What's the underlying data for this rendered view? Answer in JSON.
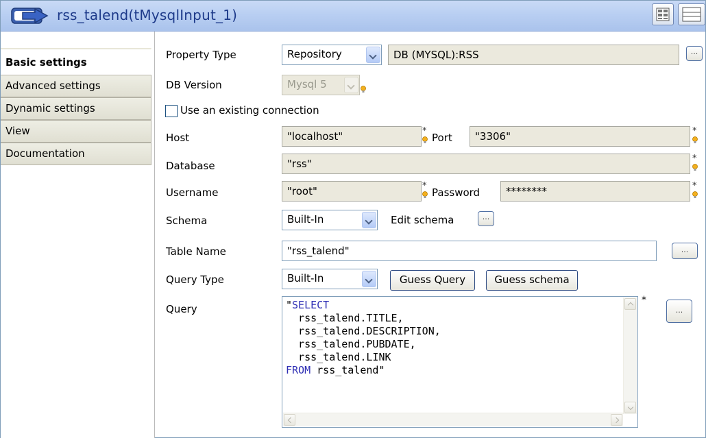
{
  "header": {
    "title": "rss_talend(tMysqlInput_1)",
    "background": "#b9cff2",
    "title_color": "#1d3a8a"
  },
  "sidebar": {
    "tabs": [
      {
        "label": "Basic settings",
        "active": true
      },
      {
        "label": "Advanced settings",
        "active": false
      },
      {
        "label": "Dynamic settings",
        "active": false
      },
      {
        "label": "View",
        "active": false
      },
      {
        "label": "Documentation",
        "active": false
      }
    ]
  },
  "form": {
    "property_type": {
      "label": "Property Type",
      "value": "Repository",
      "repository": "DB (MYSQL):RSS"
    },
    "db_version": {
      "label": "DB Version",
      "value": "Mysql 5"
    },
    "use_existing_connection": {
      "label": "Use an existing connection",
      "checked": false
    },
    "host": {
      "label": "Host",
      "value": "\"localhost\""
    },
    "port": {
      "label": "Port",
      "value": "\"3306\""
    },
    "database": {
      "label": "Database",
      "value": "\"rss\""
    },
    "username": {
      "label": "Username",
      "value": "\"root\""
    },
    "password": {
      "label": "Password",
      "value": "********"
    },
    "schema": {
      "label": "Schema",
      "value": "Built-In",
      "edit_label": "Edit schema"
    },
    "table_name": {
      "label": "Table Name",
      "value": "\"rss_talend\""
    },
    "query_type": {
      "label": "Query Type",
      "value": "Built-In"
    },
    "guess_query_label": "Guess Query",
    "guess_schema_label": "Guess schema",
    "query": {
      "label": "Query",
      "lines": [
        {
          "prefix": "\"",
          "keyword": "SELECT",
          "rest": ""
        },
        {
          "prefix": "  rss_talend.TITLE,",
          "keyword": "",
          "rest": ""
        },
        {
          "prefix": "  rss_talend.DESCRIPTION,",
          "keyword": "",
          "rest": ""
        },
        {
          "prefix": "  rss_talend.PUBDATE,",
          "keyword": "",
          "rest": ""
        },
        {
          "prefix": "  rss_talend.LINK",
          "keyword": "",
          "rest": ""
        },
        {
          "prefix": "",
          "keyword": "FROM",
          "rest": " rss_talend\""
        }
      ]
    },
    "ellipsis": "...",
    "required_marker": "*"
  }
}
